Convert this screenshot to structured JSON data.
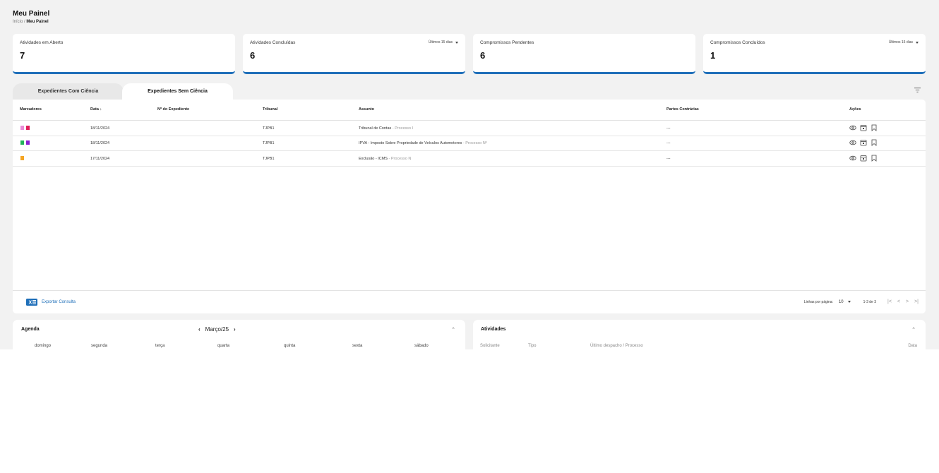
{
  "page": {
    "title": "Meu Painel",
    "breadcrumb": {
      "home": "Início",
      "separator": "/",
      "current": "Meu Painel"
    }
  },
  "stats": [
    {
      "label": "Atividades em Aberto",
      "value": "7",
      "period": ""
    },
    {
      "label": "Atividades Concluídas",
      "value": "6",
      "period": "Últimos 15 dias"
    },
    {
      "label": "Compromissos Pendentes",
      "value": "6",
      "period": ""
    },
    {
      "label": "Compromissos Concluídos",
      "value": "1",
      "period": "Últimos 15 dias"
    }
  ],
  "tabs": {
    "with_science": "Expedientes Com Ciência",
    "without_science": "Expedientes Sem Ciência",
    "active": "without_science"
  },
  "table": {
    "headers": {
      "markers": "Marcadores",
      "date": "Data",
      "expedient": "Nº do Expediente",
      "court": "Tribunal",
      "subject": "Assunto",
      "parties": "Partes Contrárias",
      "actions": "Ações"
    },
    "sort_indicator": "↓",
    "rows": [
      {
        "markers": [
          "#e98bd6",
          "#e01e5a"
        ],
        "date": "18/11/2024",
        "expedient": "",
        "court": "TJPB1",
        "subject": "Tribunal de Contas",
        "process": "Processo I",
        "parties": "---"
      },
      {
        "markers": [
          "#22b35a",
          "#8a1fd3"
        ],
        "date": "18/11/2024",
        "expedient": "",
        "court": "TJPB1",
        "subject": "IPVA - Imposto Sobre Propriedade de Veículos Automotores",
        "process": "Processo Nº",
        "parties": "---"
      },
      {
        "markers": [
          "#f5a524"
        ],
        "date": "17/11/2024",
        "expedient": "",
        "court": "TJPB1",
        "subject": "Exclusão - ICMS",
        "process": "Processo N",
        "parties": "---"
      }
    ],
    "actions_icons": [
      "eye-icon",
      "calendar-icon",
      "bookmark-icon"
    ]
  },
  "footer": {
    "export_label": "Exportar Consulta",
    "rows_per_page_label": "Linhas por página:",
    "rows_per_page": "10",
    "range": "1-3 de 3",
    "nav": {
      "first": "|<",
      "prev": "<",
      "next": ">",
      "last": ">|"
    }
  },
  "agenda": {
    "title": "Agenda",
    "month": "Março/25",
    "prev": "‹",
    "next": "›",
    "collapse": "⌃",
    "weekdays": [
      "domingo",
      "segunda",
      "terça",
      "quarta",
      "quinta",
      "sexta",
      "sábado"
    ]
  },
  "activities": {
    "title": "Atividades",
    "collapse": "⌃",
    "headers": {
      "requester": "Solicitante",
      "type": "Tipo",
      "last_dispatch": "Último despacho / Processo",
      "date": "Data"
    }
  },
  "colors": {
    "accent": "#1f6fb9",
    "background": "#f2f2f2"
  }
}
